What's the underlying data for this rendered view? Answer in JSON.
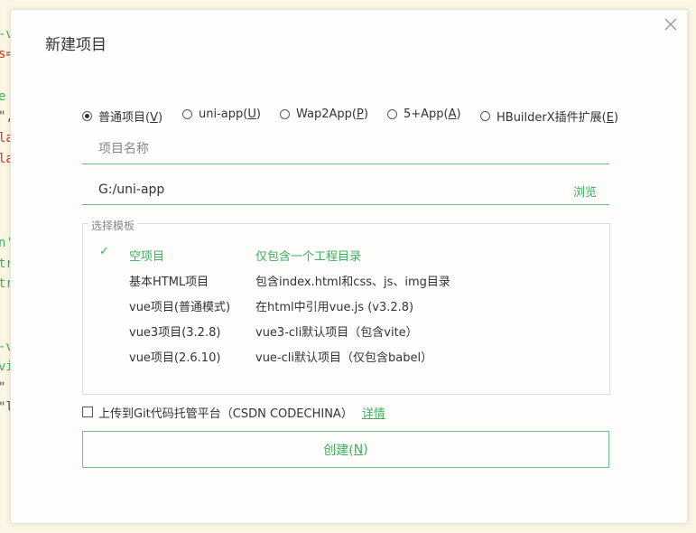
{
  "background_editor": {
    "fragments": [
      {
        "text": "-v",
        "color": "#3fae5f"
      },
      {
        "text": "s=",
        "color": "#c0392b"
      },
      {
        "text": "e",
        "color": "#3fae5f"
      },
      {
        "text": "\",",
        "color": "#555555"
      },
      {
        "text": "la",
        "color": "#c0392b"
      },
      {
        "text": "la",
        "color": "#c0392b"
      },
      {
        "text": "n'",
        "color": "#3fae5f"
      },
      {
        "text": "tr",
        "color": "#3fae5f"
      },
      {
        "text": "tr",
        "color": "#3fae5f"
      },
      {
        "text": "-v",
        "color": "#3fae5f"
      },
      {
        "text": "vi",
        "color": "#3fae5f"
      },
      {
        "text": "\"",
        "color": "#555555"
      },
      {
        "text": "\"l",
        "color": "#555555"
      }
    ]
  },
  "dialog": {
    "title": "新建项目",
    "close_icon": "close-icon",
    "project_types": [
      {
        "label": "普通项目(",
        "key": "V",
        "suffix": ")",
        "checked": true
      },
      {
        "label": "uni-app(",
        "key": "U",
        "suffix": ")",
        "checked": false
      },
      {
        "label": "Wap2App(",
        "key": "P",
        "suffix": ")",
        "checked": false
      },
      {
        "label": "5+App(",
        "key": "A",
        "suffix": ")",
        "checked": false
      },
      {
        "label": "HBuilderX插件扩展(",
        "key": "E",
        "suffix": ")",
        "checked": false
      }
    ],
    "name_field": {
      "placeholder": "项目名称",
      "value": ""
    },
    "path_field": {
      "value": "G:/uni-app",
      "browse_label": "浏览"
    },
    "templates": {
      "legend": "选择模板",
      "rows": [
        {
          "name": "空项目",
          "desc": "仅包含一个工程目录",
          "selected": true
        },
        {
          "name": "基本HTML项目",
          "desc": "包含index.html和css、js、img目录",
          "selected": false
        },
        {
          "name": "vue项目(普通模式)",
          "desc": "在html中引用vue.js (v3.2.8)",
          "selected": false
        },
        {
          "name": "vue3项目(3.2.8)",
          "desc": "vue3-cli默认项目（包含vite）",
          "selected": false
        },
        {
          "name": "vue项目(2.6.10)",
          "desc": "vue-cli默认项目（仅包含babel）",
          "selected": false
        }
      ]
    },
    "git_upload": {
      "label": "上传到Git代码托管平台（CSDN CODECHINA）",
      "details_label": "详情",
      "checked": false
    },
    "create_button": {
      "label": "创建(",
      "key": "N",
      "suffix": ")"
    },
    "accent_color": "#3fae5f"
  }
}
